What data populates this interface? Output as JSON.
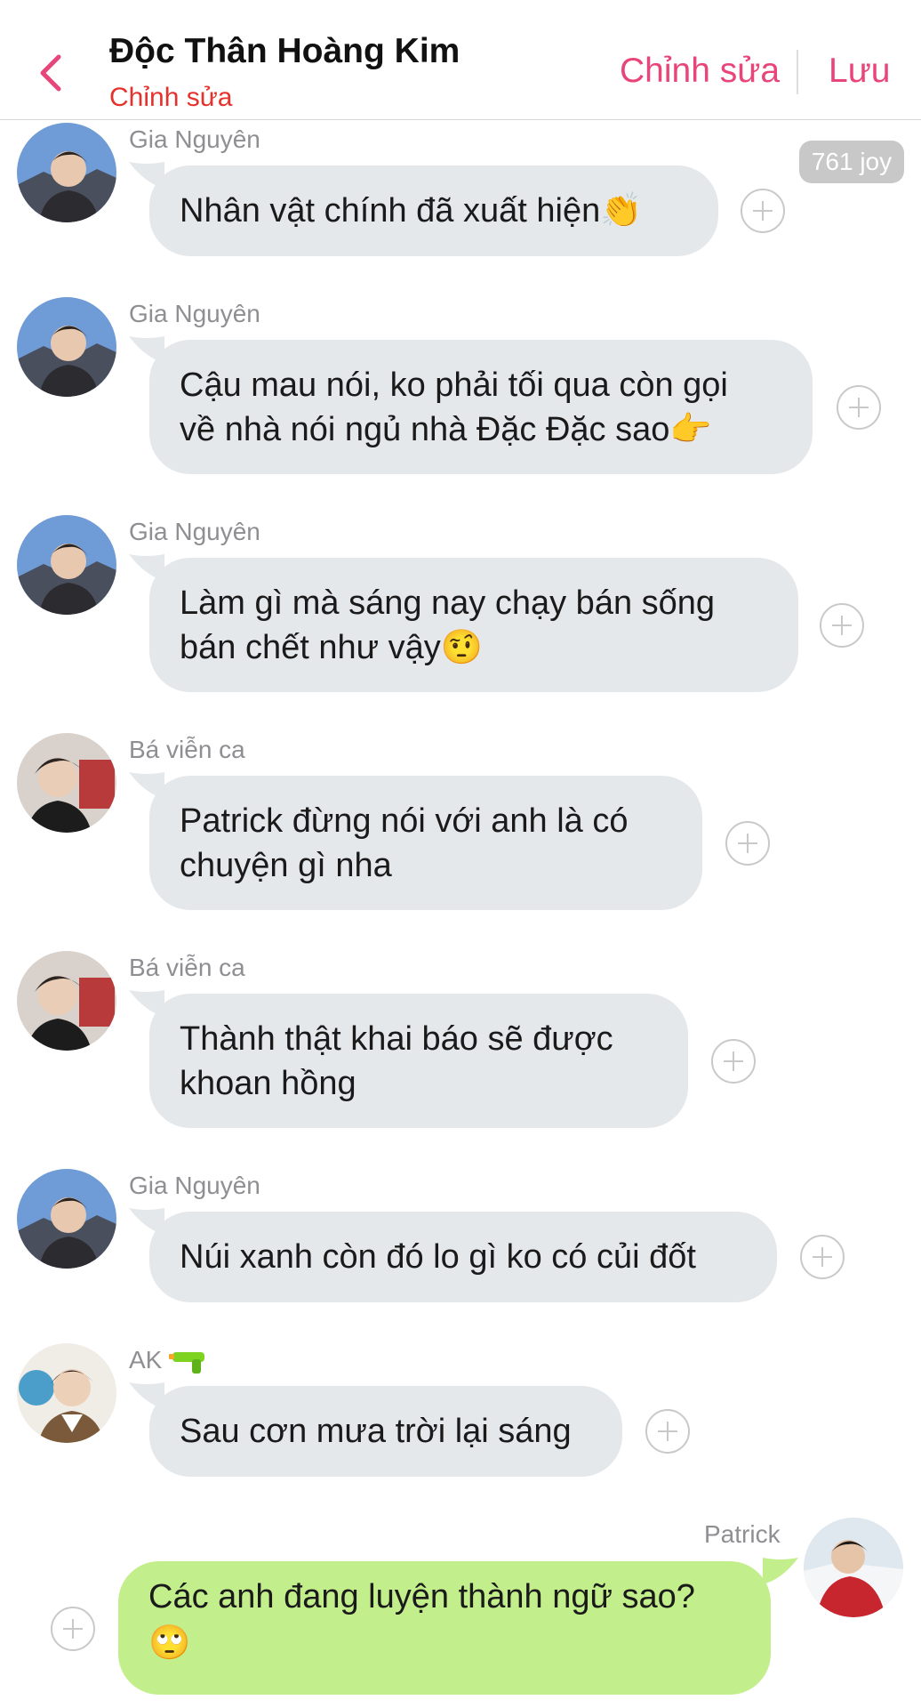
{
  "header": {
    "title": "Độc Thân Hoàng Kim",
    "subtitle": "Chỉnh sửa",
    "edit_label": "Chỉnh sửa",
    "save_label": "Lưu"
  },
  "joy_badge": "761 joy",
  "messages": [
    {
      "sender": "Gia Nguyên",
      "text": "Nhân vật chính đã xuất hiện👏"
    },
    {
      "sender": "Gia Nguyên",
      "text": "Cậu mau nói, ko phải tối qua còn gọi\nvề nhà nói ngủ nhà Đặc Đặc sao👉"
    },
    {
      "sender": "Gia Nguyên",
      "text": "Làm gì mà sáng nay chạy bán sống\nbán chết như vậy🤨"
    },
    {
      "sender": "Bá viễn ca",
      "text": "Patrick đừng nói với anh là có\nchuyện gì nha"
    },
    {
      "sender": "Bá viễn ca",
      "text": "Thành thật khai báo sẽ được\nkhoan hồng"
    },
    {
      "sender": "Gia Nguyên",
      "text": "Núi xanh còn đó lo gì ko có củi đốt"
    },
    {
      "sender": "AK",
      "text": "Sau cơn mưa trời lại sáng"
    }
  ],
  "outgoing": {
    "sender": "Patrick",
    "text": "Các anh đang luyện thành ngữ sao?\n🙄"
  },
  "colors": {
    "accent": "#e8467a",
    "subtitle": "#e5322c",
    "incoming_bubble": "#e4e8eb",
    "outgoing_bubble": "#c3ee8c"
  }
}
